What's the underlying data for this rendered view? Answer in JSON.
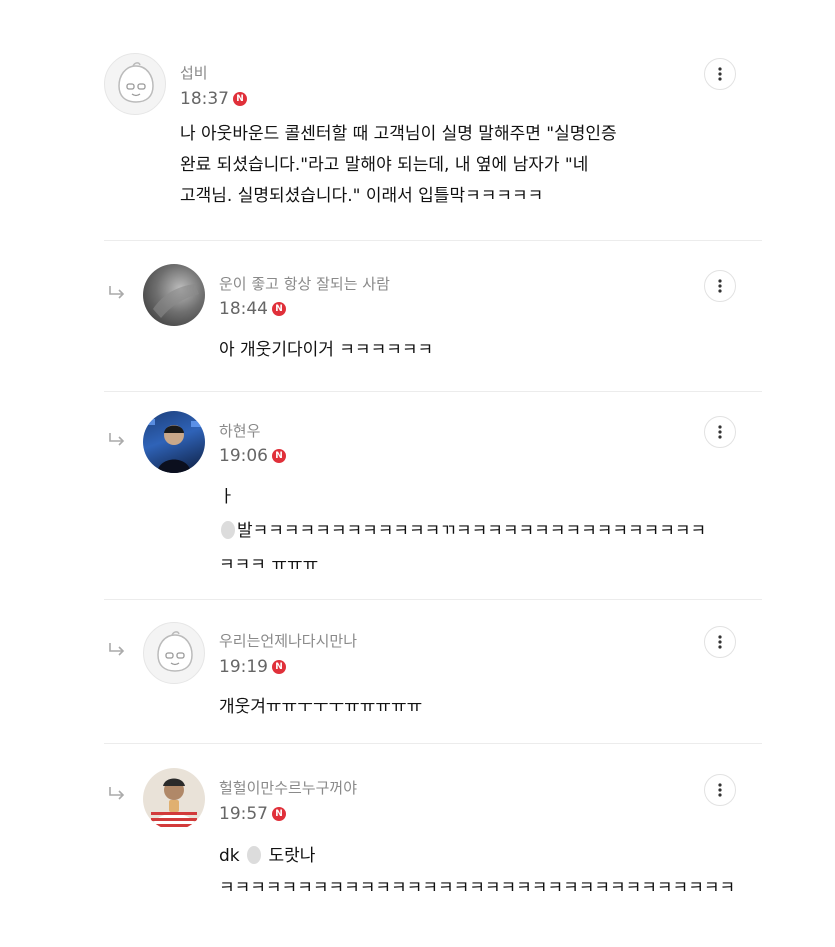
{
  "comments": [
    {
      "author": "섭비",
      "time": "18:37",
      "badge": "N",
      "lines": [
        "나 아웃바운드 콜센터할 때 고객님이 실명 말해주면 \"실명인증",
        "완료 되셨습니다.\"라고 말해야 되는데, 내 옆에 남자가 \"네",
        "고객님. 실명되셨습니다.\" 이래서 입틀막ㅋㅋㅋㅋㅋ"
      ],
      "avatar_icon": "mascot-avatar-icon"
    },
    {
      "author": "운이 좋고 항상 잘되는 사람",
      "time": "18:44",
      "badge": "N",
      "lines": [
        "아 개웃기다이거 ㅋㅋㅋㅋㅋㅋ"
      ],
      "avatar_icon": "photo-avatar-dark"
    },
    {
      "author": "하현우",
      "time": "19:06",
      "badge": "N",
      "lines": [
        "ㅏ",
        "발ㅋㅋㅋㅋㅋㅋㅋㅋㅋㅋㅋㅋㄲㅋㅋㅋㅋㅋㅋㅋㅋㅋㅋㅋㅋㅋㅋㅋㅋ",
        "ㅋㅋㅋ ㅠㅠㅠ"
      ],
      "avatar_icon": "photo-avatar-blue"
    },
    {
      "author": "우리는언제나다시만나",
      "time": "19:19",
      "badge": "N",
      "lines": [
        "개웃겨ㅠㅠㅜㅜㅜㅠㅠㅠㅠㅠ"
      ],
      "avatar_icon": "mascot-avatar-icon"
    },
    {
      "author": "헐헐이만수르누구꺼야",
      "time": "19:57",
      "badge": "N",
      "lines": [
        "dk",
        "도랏나",
        "ㅋㅋㅋㅋㅋㅋㅋㅋㅋㅋㅋㅋㅋㅋㅋㅋㅋㅋㅋㅋㅋㅋㅋㅋㅋㅋㅋㅋㅋㅋㅋㅋㅋ"
      ],
      "avatar_icon": "photo-avatar-striped"
    }
  ],
  "colors": {
    "badge": "#e0303a",
    "author": "#8a8a8a",
    "divider": "#ececec"
  }
}
